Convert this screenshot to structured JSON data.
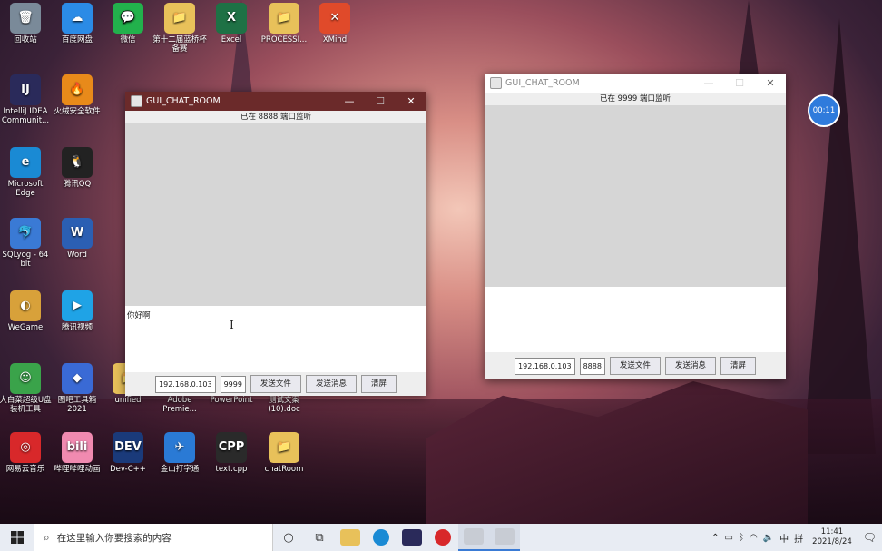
{
  "desktop_icons": [
    {
      "label": "回收站",
      "color": "#7a8a99",
      "glyph": "🗑"
    },
    {
      "label": "百度网盘",
      "color": "#2b8be6",
      "glyph": "☁"
    },
    {
      "label": "微信",
      "color": "#22b14c",
      "glyph": "💬"
    },
    {
      "label": "第十二届蓝桥杯备赛",
      "color": "#e8c15a",
      "glyph": "📁"
    },
    {
      "label": "Excel",
      "color": "#1e7145",
      "glyph": "X"
    },
    {
      "label": "PROCESSI...",
      "color": "#e8c15a",
      "glyph": "📁"
    },
    {
      "label": "XMind",
      "color": "#e04a2a",
      "glyph": "✕"
    },
    {
      "label": "IntelliJ IDEA Communit...",
      "color": "#2a2a5a",
      "glyph": "IJ"
    },
    {
      "label": "火绒安全软件",
      "color": "#e88a1a",
      "glyph": "🔥"
    },
    {
      "label": "Microsoft Edge",
      "color": "#1a8ad4",
      "glyph": "e"
    },
    {
      "label": "腾讯QQ",
      "color": "#222222",
      "glyph": "🐧"
    },
    {
      "label": "SQLyog - 64 bit",
      "color": "#3a7ad5",
      "glyph": "🐬"
    },
    {
      "label": "Word",
      "color": "#2b5fb3",
      "glyph": "W"
    },
    {
      "label": "WeGame",
      "color": "#d8a13a",
      "glyph": "◐"
    },
    {
      "label": "腾讯视频",
      "color": "#1fa3e6",
      "glyph": "▶"
    },
    {
      "label": "大白菜超级U盘装机工具",
      "color": "#3aa34a",
      "glyph": "☺"
    },
    {
      "label": "图吧工具箱2021",
      "color": "#3a6ad5",
      "glyph": "◆"
    },
    {
      "label": "网易云音乐",
      "color": "#d8282a",
      "glyph": "◎"
    },
    {
      "label": "哔哩哔哩动画",
      "color": "#f08ab0",
      "glyph": "bili"
    },
    {
      "label": "Dev-C++",
      "color": "#1a3a7a",
      "glyph": "DEV"
    },
    {
      "label": "金山打字通",
      "color": "#2a7ad5",
      "glyph": "✈"
    },
    {
      "label": "text.cpp",
      "color": "#2a2a2a",
      "glyph": "CPP"
    },
    {
      "label": "chatRoom",
      "color": "#e8c15a",
      "glyph": "📁"
    },
    {
      "label": "unified",
      "color": "#e8c15a",
      "glyph": "📁"
    },
    {
      "label": "Adobe Premie...",
      "color": "#2a1a4a",
      "glyph": "Pr"
    },
    {
      "label": "PowerPoint",
      "color": "#c44a2a",
      "glyph": "P"
    },
    {
      "label": "测试文案(10).doc",
      "color": "#2b5fb3",
      "glyph": "W"
    }
  ],
  "window_left": {
    "title": "GUI_CHAT_ROOM",
    "status": "已在 8888 端口监听",
    "input_text": "你好啊",
    "ip": "192.168.0.103",
    "port": "9999",
    "btn_file": "发送文件",
    "btn_send": "发送消息",
    "btn_clear": "清屏",
    "btn_min": "—",
    "btn_max": "☐",
    "btn_close": "✕"
  },
  "window_right": {
    "title": "GUI_CHAT_ROOM",
    "status": "已在 9999 端口监听",
    "input_text": "",
    "ip": "192.168.0.103",
    "port": "8888",
    "btn_file": "发送文件",
    "btn_send": "发送消息",
    "btn_clear": "清屏",
    "btn_min": "—",
    "btn_max": "☐",
    "btn_close": "✕"
  },
  "timer": "00:11",
  "taskbar": {
    "search_placeholder": "在这里输入你要搜索的内容",
    "tray_lang": "中",
    "tray_ime": "拼",
    "time": "11:41",
    "date": "2021/8/24"
  }
}
